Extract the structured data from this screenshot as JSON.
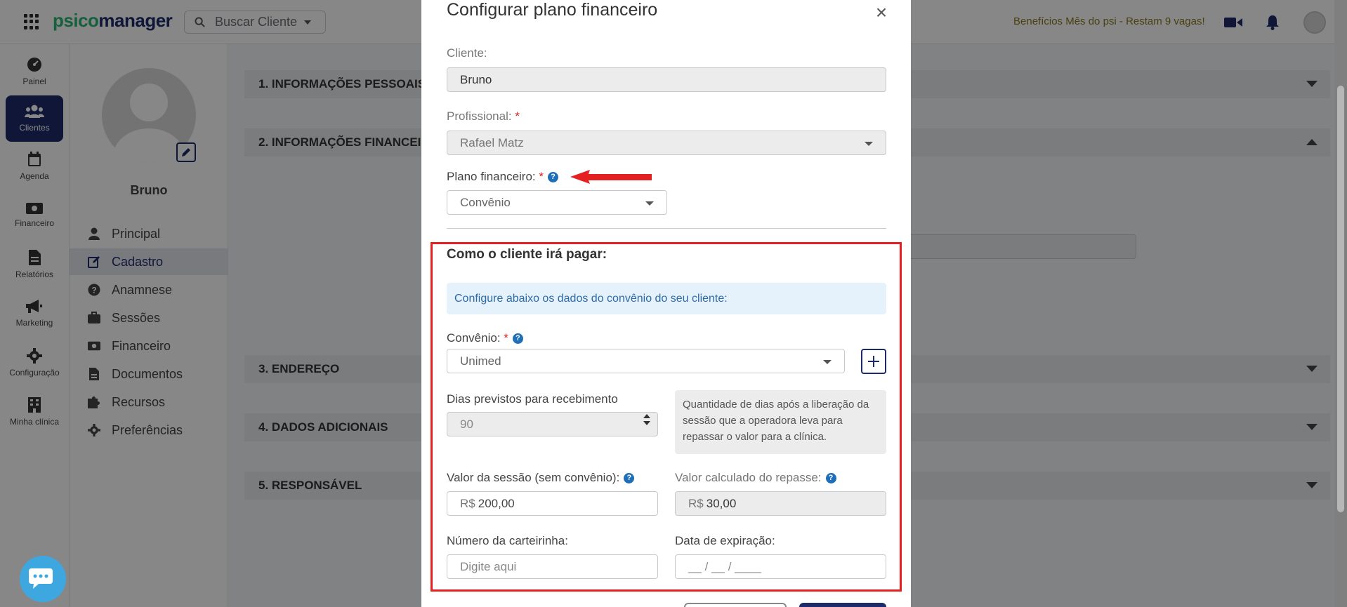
{
  "topbar": {
    "logo_part1": "psico",
    "logo_part2": "manager",
    "search_label": "Buscar Cliente",
    "promo": "Benefícios Mês do psi - Restam 9 vagas!"
  },
  "leftnav": [
    {
      "label": "Painel",
      "icon": "dashboard-icon"
    },
    {
      "label": "Clientes",
      "icon": "users-icon",
      "active": true
    },
    {
      "label": "Agenda",
      "icon": "calendar-icon"
    },
    {
      "label": "Financeiro",
      "icon": "money-icon"
    },
    {
      "label": "Relatórios",
      "icon": "file-icon"
    },
    {
      "label": "Marketing",
      "icon": "megaphone-icon"
    },
    {
      "label": "Configuração",
      "icon": "gear-icon"
    },
    {
      "label": "Minha clínica",
      "icon": "building-icon"
    }
  ],
  "profile": {
    "name": "Bruno",
    "menu": [
      {
        "label": "Principal",
        "icon": "user-icon"
      },
      {
        "label": "Cadastro",
        "icon": "edit-icon",
        "active": true
      },
      {
        "label": "Anamnese",
        "icon": "question-icon"
      },
      {
        "label": "Sessões",
        "icon": "briefcase-icon"
      },
      {
        "label": "Financeiro",
        "icon": "money-icon"
      },
      {
        "label": "Documentos",
        "icon": "document-icon"
      },
      {
        "label": "Recursos",
        "icon": "puzzle-icon"
      },
      {
        "label": "Preferências",
        "icon": "gear-icon"
      }
    ]
  },
  "sections": [
    {
      "label": "1. INFORMAÇÕES PESSOAIS"
    },
    {
      "label": "2. INFORMAÇÕES FINANCEIRAS"
    },
    {
      "label": "3. ENDEREÇO"
    },
    {
      "label": "4. DADOS ADICIONAIS"
    },
    {
      "label": "5. RESPONSÁVEL"
    }
  ],
  "modal": {
    "title": "Configurar plano financeiro",
    "close": "×",
    "cliente_label": "Cliente:",
    "cliente_value": "Bruno",
    "profissional_label": "Profissional:",
    "profissional_value": "Rafael Matz",
    "plano_label": "Plano financeiro:",
    "plano_value": "Convênio",
    "required_mark": "*",
    "help_mark": "?",
    "how_title": "Como o cliente irá pagar:",
    "info_text": "Configure abaixo os dados do convênio do seu cliente:",
    "convenio_label": "Convênio:",
    "convenio_value": "Unimed",
    "dias_label": "Dias previstos para recebimento",
    "dias_value": "90",
    "dias_hint": "Quantidade de dias após a liberação da sessão que a operadora leva para repassar o valor para a clínica.",
    "valor_sessao_label": "Valor da sessão (sem convênio):",
    "valor_sessao_prefix": "R$",
    "valor_sessao_value": "200,00",
    "repasse_label": "Valor calculado do repasse:",
    "repasse_prefix": "R$",
    "repasse_value": "30,00",
    "carteirinha_label": "Número da carteirinha:",
    "carteirinha_placeholder": "Digite aqui",
    "expiracao_label": "Data de expiração:",
    "expiracao_placeholder": "__ / __ / ____"
  },
  "colors": {
    "brand_navy": "#1d2b6b",
    "brand_green": "#2bb673",
    "highlight_red": "#e52020",
    "help_blue": "#1f6fb8"
  }
}
